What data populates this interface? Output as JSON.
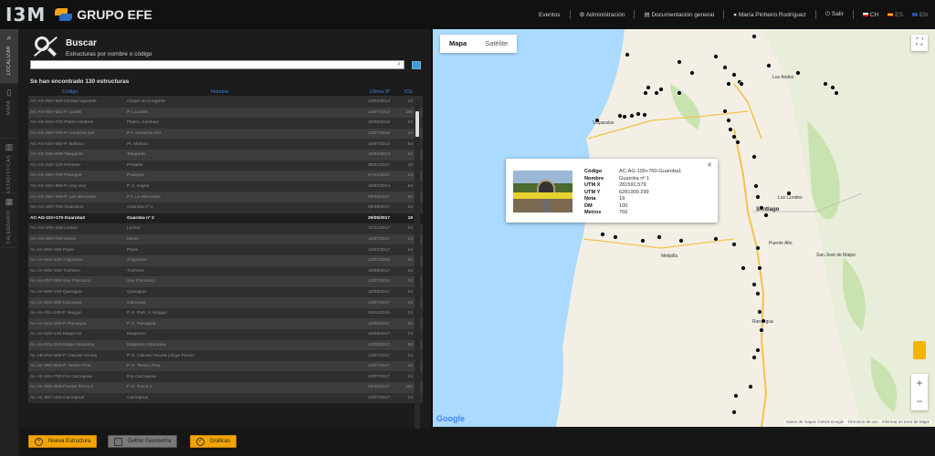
{
  "header": {
    "logo_text": "I3M",
    "brand": "GRUPO EFE",
    "nav": [
      {
        "label": "Eventos"
      },
      {
        "label": "Administración"
      },
      {
        "label": "Documentación general"
      },
      {
        "label": "María Pinheiro Rodríguez"
      },
      {
        "label": "Salir"
      }
    ],
    "languages": [
      "CH",
      "ES",
      "EN"
    ]
  },
  "sidebar": {
    "items": [
      {
        "label": "LOCALIZAR",
        "icon": "map-search-icon",
        "active": true
      },
      {
        "label": "MAPA",
        "icon": "document-icon",
        "active": false
      },
      {
        "label": "ESTADÍSTICAS",
        "icon": "bar-chart-icon",
        "active": false
      },
      {
        "label": "CALENDARIO",
        "icon": "calendar-icon",
        "active": false
      }
    ]
  },
  "search": {
    "title": "Buscar",
    "subtitle": "Estructuras por nombre o código",
    "input_value": "",
    "input_placeholder": "",
    "result_count": "Se han encontrado 130 estructuras"
  },
  "table": {
    "columns": [
      "Código",
      "Nombre",
      "Última IP",
      "ICE"
    ],
    "rows": [
      {
        "code": "AC-AG-000+680-Chorpe laguante",
        "name": "Cerpie de la lagarte",
        "date": "13/02/2014",
        "ice": "24"
      },
      {
        "code": "AC-AG-001+021-P. Loa08",
        "name": "P. L.Loa08",
        "date": "13/07/2014",
        "ice": "100"
      },
      {
        "code": "AC-AG-003+720-Plateo lombres",
        "name": "Plateo, Sambain",
        "date": "26/06/2015",
        "ice": "23"
      },
      {
        "code": "AC-AG-000+700-P. Amatiche Est",
        "name": "P.T. Amatiche Est",
        "date": "13/07/2015",
        "ice": "24"
      },
      {
        "code": "AC-AG-020+080-P. Malloco",
        "name": "Pt. Malloco",
        "date": "15/07/2014",
        "ice": "64"
      },
      {
        "code": "AC-AG-025+000-Talagante",
        "name": "Talagante",
        "date": "10/02/2014",
        "ice": "24"
      },
      {
        "code": "AC-AG-040+120-Peñaflor",
        "name": "Peñaflor",
        "date": "25/01/2017",
        "ice": "44"
      },
      {
        "code": "AC-AG-050+700-Puangue",
        "name": "Puangue",
        "date": "07/12/2017",
        "ice": "24"
      },
      {
        "code": "AC-AG-060+300-P. Llay Llay",
        "name": "P. 2. Llaylla",
        "date": "10/07/2014",
        "ice": "64"
      },
      {
        "code": "AC-AG-080+400-P. Las Mercedes",
        "name": "P.T. Lo Mercedes",
        "date": "08/09/2017",
        "ice": "54"
      },
      {
        "code": "AC-AG-100+760-Guaroba1",
        "name": "Guaroba nº 1",
        "date": "09/08/2017",
        "ice": "24"
      },
      {
        "code": "AC-AG-101+170-Guaroba2",
        "name": "Guaroba nº 2",
        "date": "29/05/2017",
        "ice": "19",
        "selected": true
      },
      {
        "code": "AC-AG-105+100-Lontue",
        "name": "Lontue",
        "date": "27/11/2017",
        "ice": "24"
      },
      {
        "code": "AC-AO-000+760-Melon",
        "name": "Melon",
        "date": "10/07/2017",
        "ice": "24"
      },
      {
        "code": "AL-AA-001+420-Panlo",
        "name": "Panlo",
        "date": "13/07/2017",
        "ice": "24"
      },
      {
        "code": "AL-AA-004+100-Angostura",
        "name": "Angostura",
        "date": "13/07/2016",
        "ice": "24"
      },
      {
        "code": "AL-AA-005+100-Tromeno",
        "name": "Tromeno",
        "date": "10/08/2017",
        "ice": "24"
      },
      {
        "code": "AL-AA-007+600-San Francisco",
        "name": "San Francisco",
        "date": "13/07/2014",
        "ice": "24"
      },
      {
        "code": "AL-AA-008+100-Quinagua",
        "name": "Quinagua",
        "date": "10/08/2017",
        "ice": "24"
      },
      {
        "code": "AL-AA-010+200-Camonas",
        "name": "Camonas",
        "date": "13/07/2017",
        "ice": "24"
      },
      {
        "code": "AL-AA-011+200-P. Maggio",
        "name": "P. E. Rub. V. Maggio",
        "date": "09/11/2016",
        "ice": "24"
      },
      {
        "code": "AL-AA-013+200-P. Paniagua",
        "name": "P. K. Paniagua",
        "date": "10/08/2017",
        "ice": "24"
      },
      {
        "code": "AL-AA-020+100-Maipo Hz",
        "name": "Maipocho",
        "date": "10/08/2017",
        "ice": "24"
      },
      {
        "code": "AL-AA-021+200-Maipo mbanana",
        "name": "Maipocho mbanana",
        "date": "13/08/2017",
        "ice": "64"
      },
      {
        "code": "AL-AB-003+900-P. Claudio Vicuña",
        "name": "P. E. Claudio Vicuña (Jorge Pérez)",
        "date": "13/07/2017",
        "ice": "24"
      },
      {
        "code": "AL-AC-000+600-P. Tambo Pelo",
        "name": "P. E. Tambo Pelo",
        "date": "13/07/2017",
        "ice": "24"
      },
      {
        "code": "AL-AC-001+700-Río Cachapoal",
        "name": "Río Cachapoal",
        "date": "13/07/2017",
        "ice": "24"
      },
      {
        "code": "AL-AC-005+900-Puente Rinca 2",
        "name": "P. E. Rinca 2",
        "date": "09/10/2017",
        "ice": "100"
      },
      {
        "code": "AL-AC-007+400-Cachapoal",
        "name": "Cachapoal",
        "date": "13/07/2017",
        "ice": "24"
      }
    ]
  },
  "actions": {
    "new_structures": "Nueva Estructura",
    "define_geometry": "Definir Geometría",
    "charts": "Gráficas"
  },
  "map": {
    "type_map": "Mapa",
    "type_satellite": "Satélite",
    "attribution": "Datos de mapas ©2019 Google · Términos de uso · Informar un error de Maps",
    "google_label": "Google",
    "city_labels": [
      "Los Andes",
      "Santiago",
      "Puente Alto",
      "Melipilla",
      "Rancagua",
      "San José de Maipo",
      "Los Condes",
      "Valparaíso"
    ],
    "zoom_in": "+",
    "zoom_out": "−",
    "popup": {
      "fields": [
        {
          "k": "Código",
          "v": "AC-AG-100+760-Guaroba1"
        },
        {
          "k": "Nombre",
          "v": "Guaroba nº 1"
        },
        {
          "k": "UTM X",
          "v": "281591.579"
        },
        {
          "k": "UTM Y",
          "v": "6281009.299"
        },
        {
          "k": "Nota",
          "v": "19"
        },
        {
          "k": "DM",
          "v": "100"
        },
        {
          "k": "Metros",
          "v": "760"
        }
      ]
    }
  },
  "colors": {
    "accent_orange": "#f2a400",
    "link_blue": "#3f7fd6",
    "water": "#aadaff",
    "land": "#f3efe5"
  }
}
